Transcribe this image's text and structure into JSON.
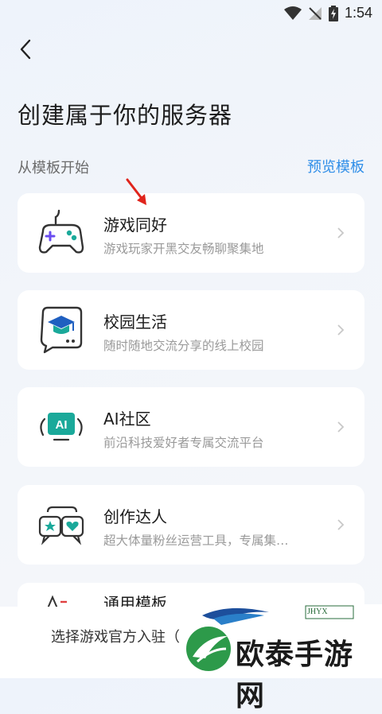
{
  "status_bar": {
    "time": "1:54"
  },
  "header": {
    "title": "创建属于你的服务器"
  },
  "section": {
    "label": "从模板开始",
    "preview_link": "预览模板"
  },
  "templates": [
    {
      "title": "游戏同好",
      "desc": "游戏玩家开黑交友畅聊聚集地",
      "icon": "gamepad-icon"
    },
    {
      "title": "校园生活",
      "desc": "随时随地交流分享的线上校园",
      "icon": "graduation-cap-icon"
    },
    {
      "title": "AI社区",
      "desc": "前沿科技爱好者专属交流平台",
      "icon": "ai-icon"
    },
    {
      "title": "创作达人",
      "desc": "超大体量粉丝运营工具，专属集…",
      "icon": "chat-bubbles-icon"
    },
    {
      "title": "通用模板",
      "desc": "",
      "icon": "template-icon"
    }
  ],
  "bottom": {
    "text": "选择游戏官方入驻（"
  },
  "watermark": {
    "text": "欧泰手游网",
    "brand": "JHYX"
  },
  "colors": {
    "accent": "#2f8ee8",
    "icon_purple": "#6a4cf0",
    "icon_teal": "#1aa99a"
  }
}
